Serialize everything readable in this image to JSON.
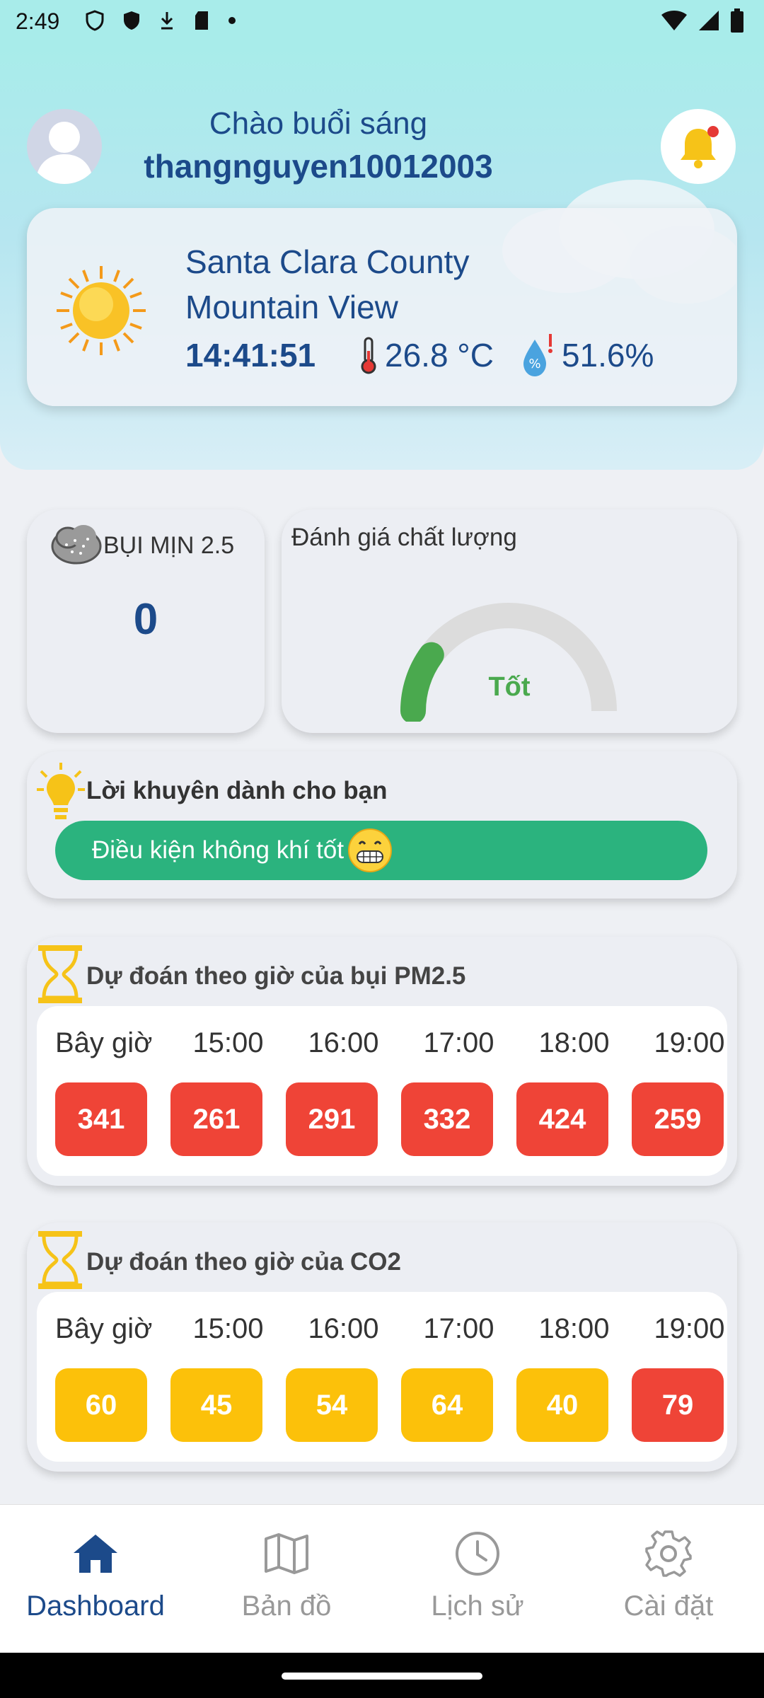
{
  "status_bar": {
    "time": "2:49"
  },
  "header": {
    "greeting": "Chào buổi sáng",
    "username": "thangnguyen10012003"
  },
  "location": {
    "county": "Santa Clara County",
    "city": "Mountain View",
    "time": "14:41:51",
    "temperature": "26.8 °C",
    "humidity": "51.6%"
  },
  "pm25": {
    "title": "BỤI MỊN 2.5",
    "value": "0"
  },
  "quality": {
    "title": "Đánh giá chất lượng",
    "label": "Tốt",
    "color": "#4aa94e",
    "level": 0.2
  },
  "advice": {
    "title": "Lời khuyên dành cho bạn",
    "message": "Điều kiện không khí tốt"
  },
  "forecast_pm": {
    "title": "Dự đoán theo giờ của bụi PM2.5",
    "hours": [
      "Bây giờ",
      "15:00",
      "16:00",
      "17:00",
      "18:00",
      "19:00"
    ],
    "values": [
      "341",
      "261",
      "291",
      "332",
      "424",
      "259"
    ],
    "levels": [
      "red",
      "red",
      "red",
      "red",
      "red",
      "red"
    ]
  },
  "forecast_co2": {
    "title": "Dự đoán theo giờ của CO2",
    "hours": [
      "Bây giờ",
      "15:00",
      "16:00",
      "17:00",
      "18:00",
      "19:00"
    ],
    "values": [
      "60",
      "45",
      "54",
      "64",
      "40",
      "79"
    ],
    "levels": [
      "yellow",
      "yellow",
      "yellow",
      "yellow",
      "yellow",
      "red"
    ]
  },
  "nav": {
    "items": [
      {
        "label": "Dashboard",
        "icon": "home-icon",
        "active": true
      },
      {
        "label": "Bản đồ",
        "icon": "map-icon",
        "active": false
      },
      {
        "label": "Lịch sử",
        "icon": "clock-icon",
        "active": false
      },
      {
        "label": "Cài đặt",
        "icon": "gear-icon",
        "active": false
      }
    ]
  },
  "colors": {
    "accent": "#1c4a8a",
    "good": "#2bb37e",
    "bad": "#ef4437",
    "warn": "#fcc10a"
  }
}
